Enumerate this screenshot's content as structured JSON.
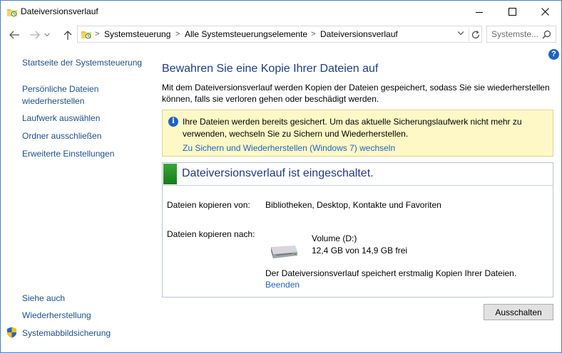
{
  "window": {
    "title": "Dateiversionsverlauf"
  },
  "address": {
    "breadcrumbs": [
      "Systemsteuerung",
      "Alle Systemsteuerungselemente",
      "Dateiversionsverlauf"
    ]
  },
  "search": {
    "placeholder": "Systemste..."
  },
  "help_label": "?",
  "sidebar": {
    "home": "Startseite der Systemsteuerung",
    "items": [
      {
        "label_line1": "Persönliche Dateien",
        "label_line2": "wiederherstellen"
      },
      {
        "label": "Laufwerk auswählen"
      },
      {
        "label": "Ordner ausschließen"
      },
      {
        "label": "Erweiterte Einstellungen"
      }
    ],
    "see_also_title": "Siehe auch",
    "see_also": [
      "Wiederherstellung",
      "Systemabbildsicherung"
    ]
  },
  "main": {
    "heading": "Bewahren Sie eine Kopie Ihrer Dateien auf",
    "description": "Mit dem Dateiversionsverlauf werden Kopien der Dateien gespeichert, sodass Sie sie wiederherstellen können, falls sie verloren gehen oder beschädigt werden.",
    "info": {
      "icon": "i",
      "text": "Ihre Dateien werden bereits gesichert. Um das aktuelle Sicherungslaufwerk nicht mehr zu verwenden, wechseln Sie zu Sichern und Wiederherstellen.",
      "link": "Zu Sichern und Wiederherstellen (Windows 7) wechseln"
    },
    "status": {
      "title": "Dateiversionsverlauf ist eingeschaltet.",
      "status_color": "#1f8f1f",
      "copy_from_label": "Dateien kopieren von:",
      "copy_from_value": "Bibliotheken, Desktop, Kontakte und Favoriten",
      "copy_to_label": "Dateien kopieren nach:",
      "drive_name": "Volume (D:)",
      "drive_space": "12,4 GB von 14,9 GB frei",
      "message": "Der Dateiversionsverlauf speichert erstmalig Kopien Ihrer Dateien.",
      "stop_link": "Beenden"
    },
    "turn_off_button": "Ausschalten"
  }
}
